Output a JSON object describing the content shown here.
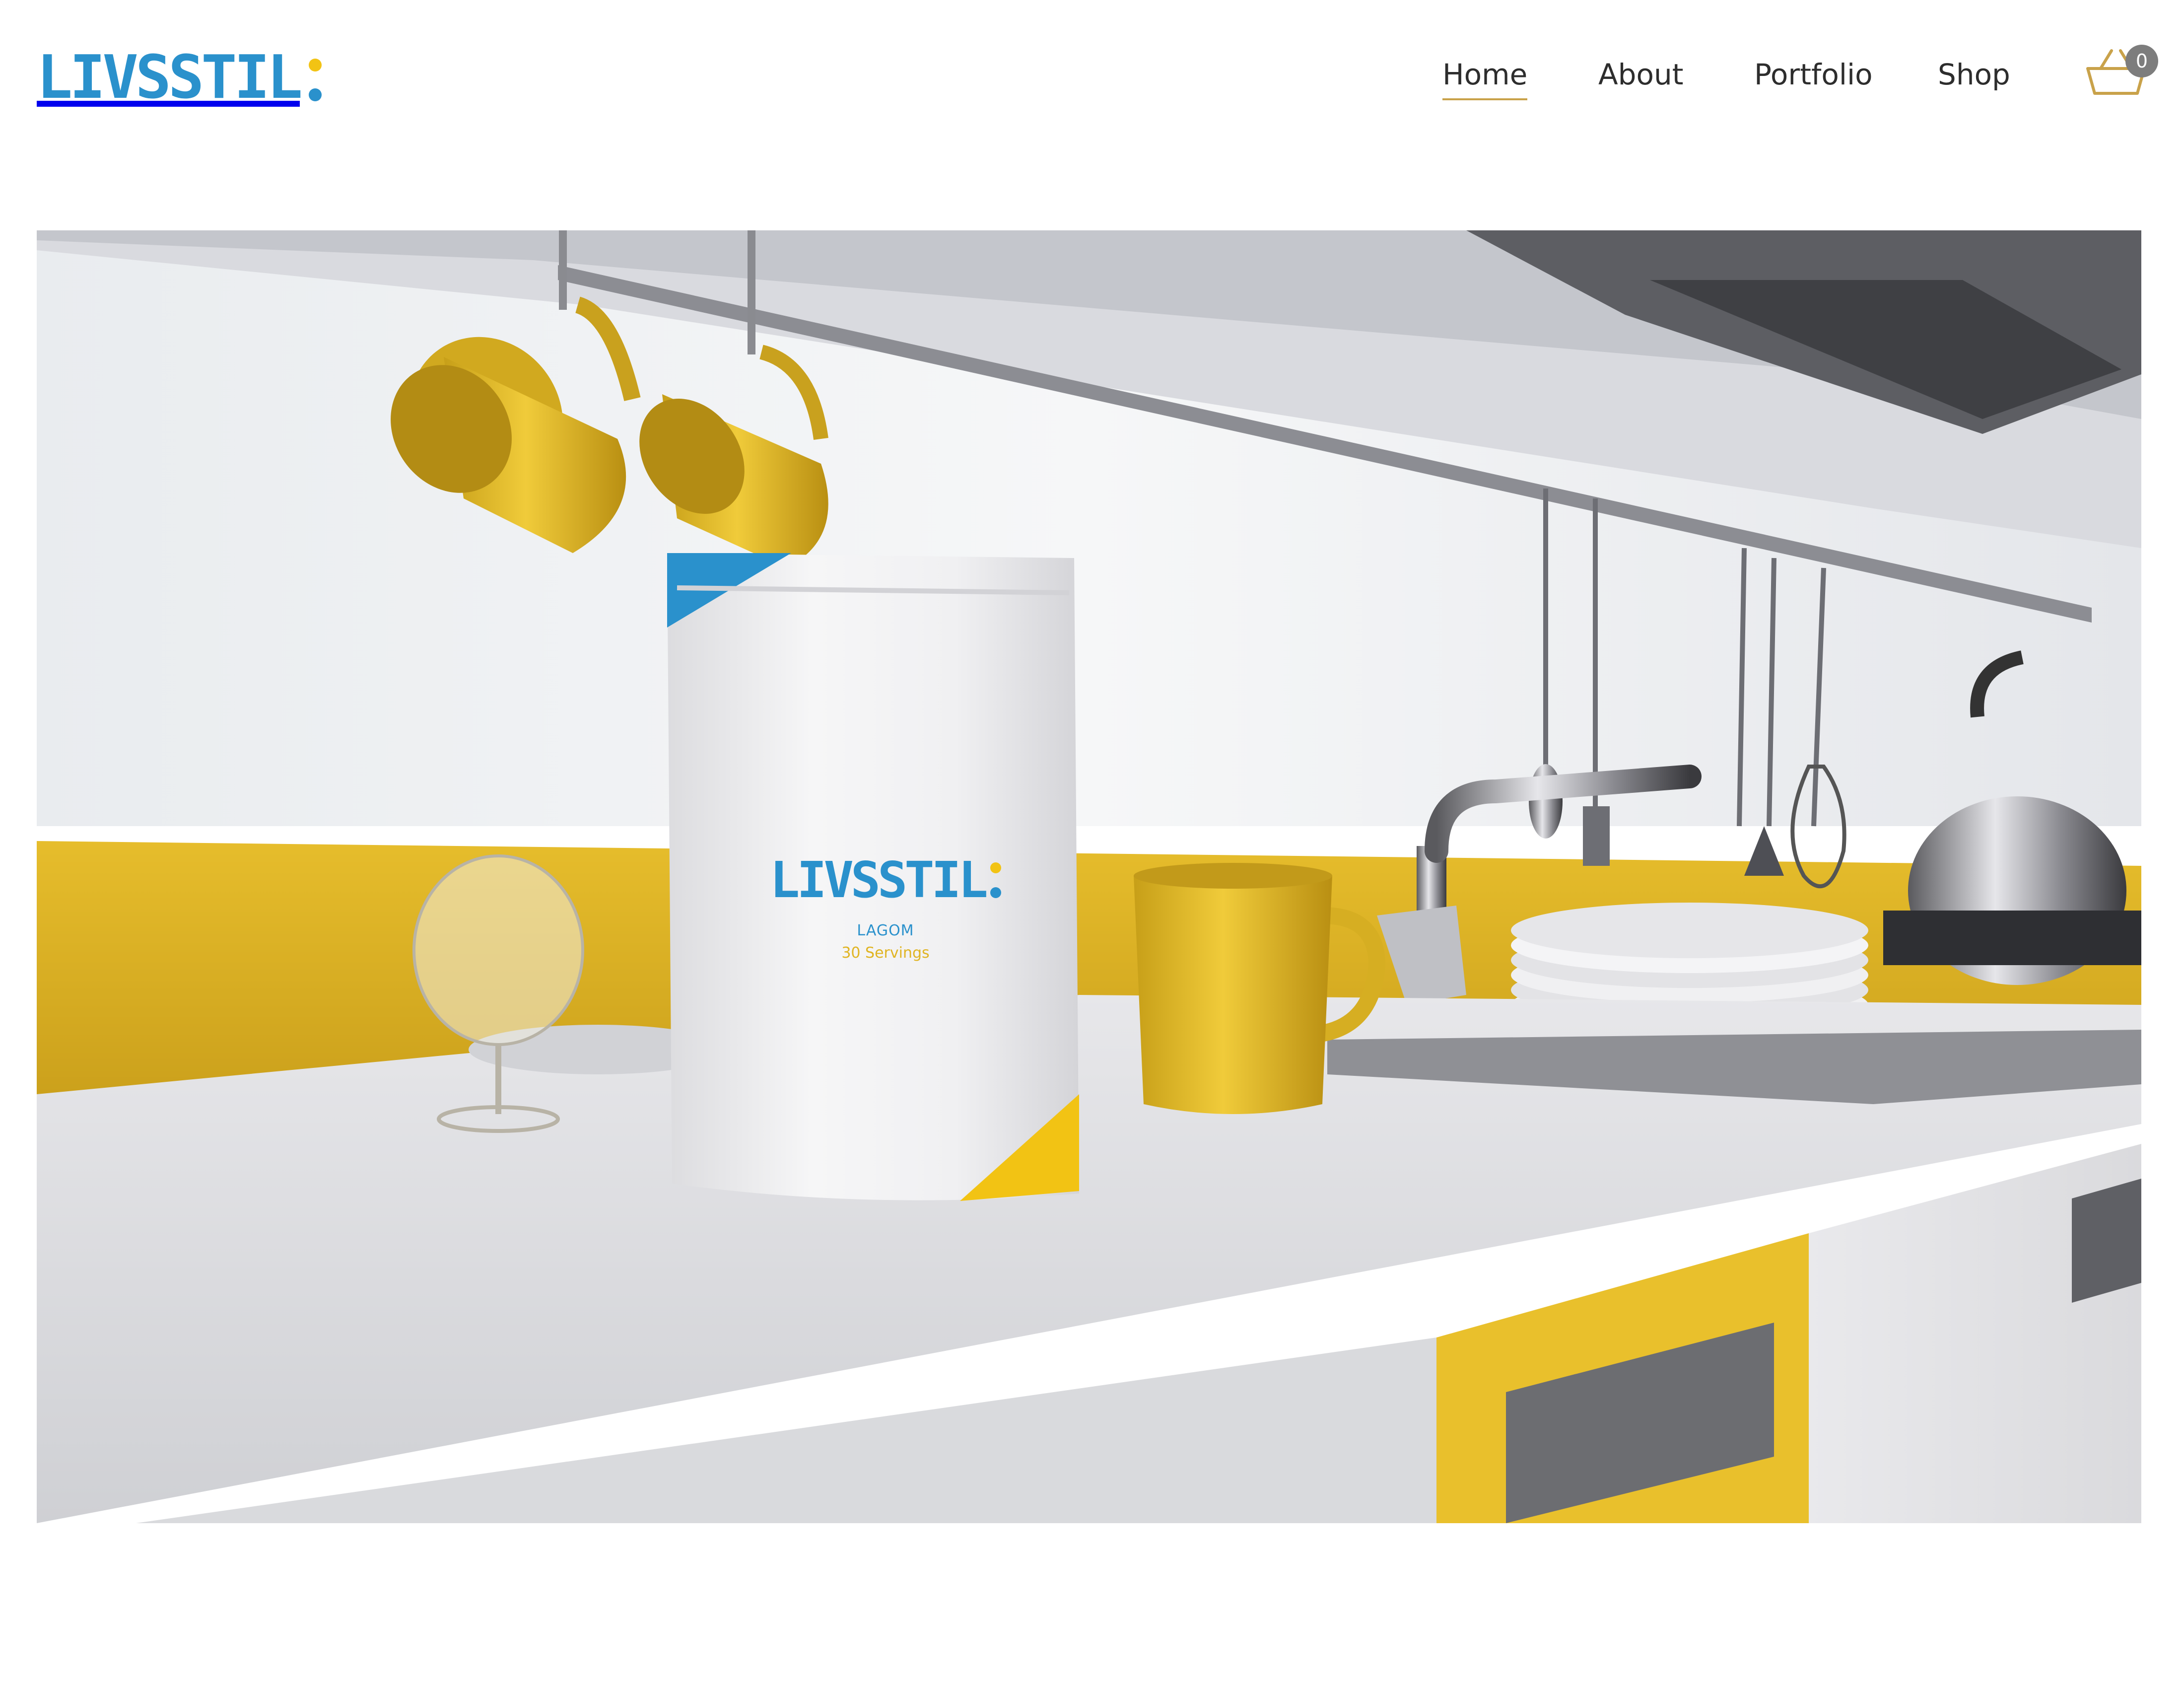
{
  "brand": {
    "name": "LIVSSTIL",
    "primary_color": "#2a91cc",
    "accent_color": "#f2c314"
  },
  "nav": {
    "items": [
      {
        "label": "Home",
        "active": true
      },
      {
        "label": "About",
        "active": false
      },
      {
        "label": "Portfolio",
        "active": false
      },
      {
        "label": "Shop",
        "active": false
      }
    ]
  },
  "cart": {
    "icon": "basket-icon",
    "count": "0"
  },
  "hero": {
    "image": "kitchen-product-mockup",
    "product": {
      "brand": "LIVSSTIL",
      "name": "LAGOM",
      "servings": "30 Servings"
    }
  }
}
